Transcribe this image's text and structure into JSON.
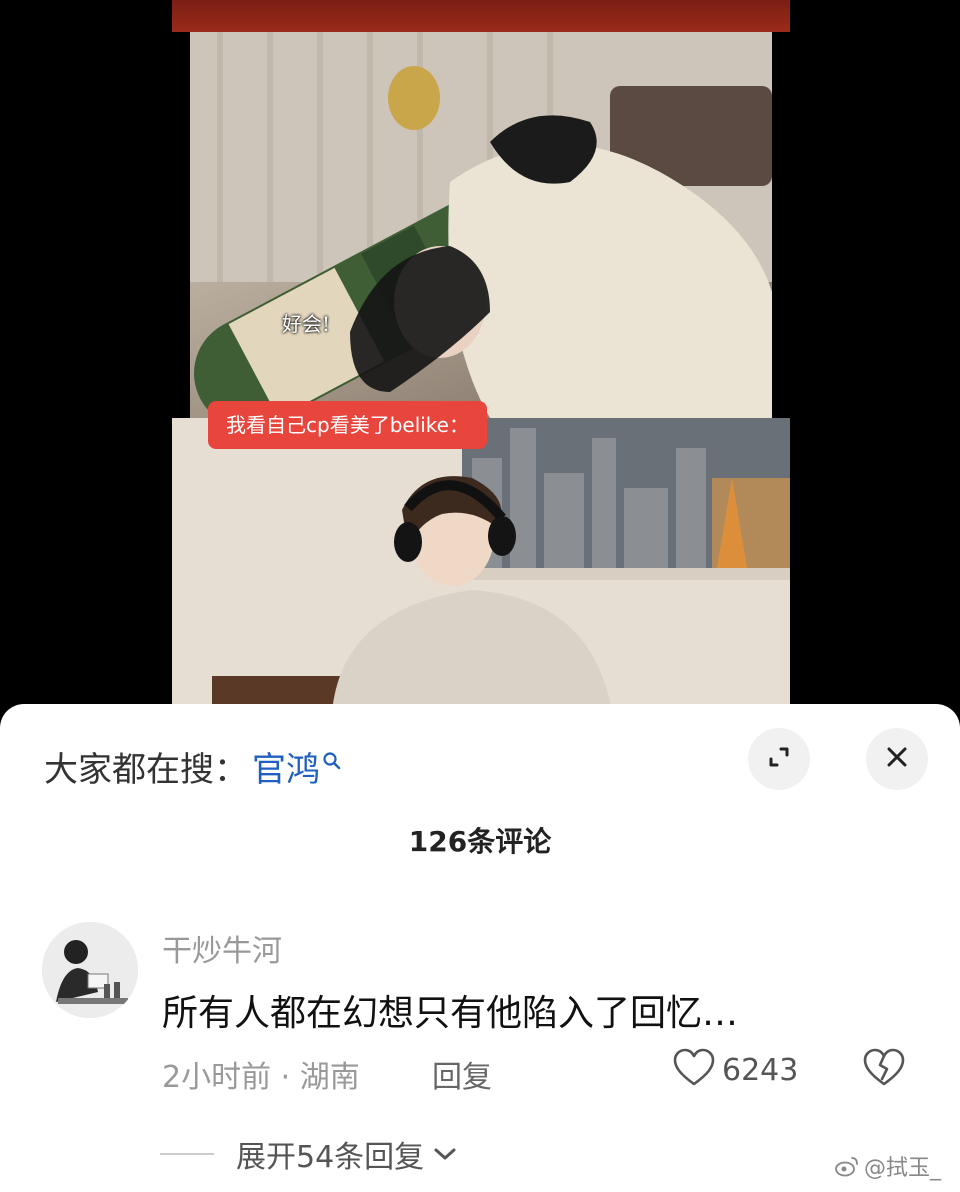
{
  "video": {
    "subtitle": "好会!",
    "caption": "我看自己cp看美了belike："
  },
  "search_hint": {
    "prefix": "大家都在搜：",
    "term": "官鸿"
  },
  "comments_header": {
    "count_label": "126条评论"
  },
  "comment": {
    "username": "干炒牛河",
    "text": "所有人都在幻想只有他陷入了回忆…",
    "time_location": "2小时前 · 湖南",
    "reply_label": "回复",
    "like_count": "6243",
    "expand_label": "展开54条回复"
  },
  "watermark": {
    "handle": "@拭玉_"
  },
  "colors": {
    "accent_link": "#1f5fbf",
    "caption_badge": "#e8453c"
  },
  "icons": [
    "search-icon",
    "expand-icon",
    "close-icon",
    "heart-icon",
    "broken-heart-icon",
    "chevron-down-icon",
    "weibo-icon"
  ]
}
